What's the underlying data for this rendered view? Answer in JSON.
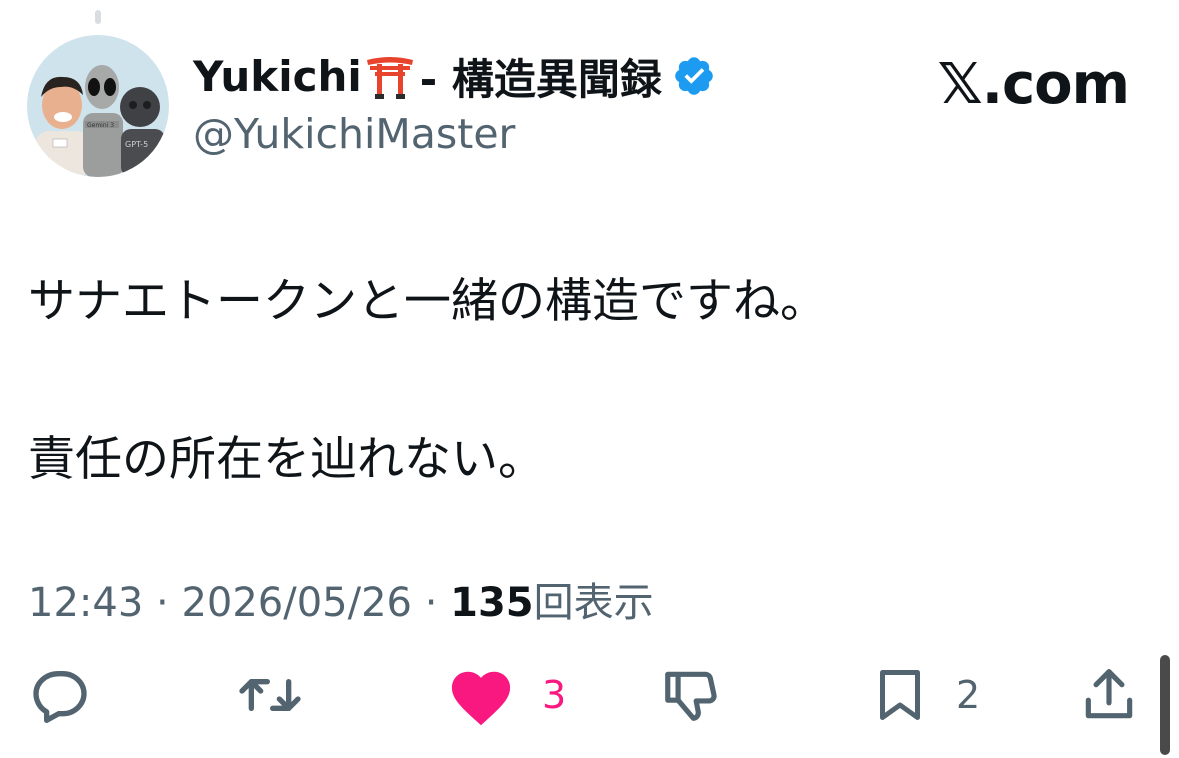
{
  "author": {
    "display_name": "Yukichi",
    "name_suffix": " - 構造異聞録",
    "handle": "@YukichiMaster",
    "verified": true,
    "name_emoji": "torii-gate-icon",
    "avatar_labels": [
      "Gemini 3",
      "GPT-5"
    ]
  },
  "site": {
    "label": "𝕏.com"
  },
  "tweet": {
    "text_line1": "サナエトークンと一緒の構造ですね。",
    "text_line2": "責任の所在を辿れない。"
  },
  "meta": {
    "time": "12:43",
    "separator": " · ",
    "date": "2026/05/26",
    "views_count": "135",
    "views_label": "回表示"
  },
  "actions": {
    "reply_icon": "reply-icon",
    "retweet_icon": "retweet-icon",
    "like_icon": "heart-icon",
    "like_count": "3",
    "dislike_icon": "dislike-icon",
    "bookmark_icon": "bookmark-icon",
    "bookmark_count": "2",
    "share_icon": "share-icon"
  },
  "colors": {
    "text": "#0f1419",
    "secondary": "#536471",
    "like_pink": "#f91880",
    "verified_blue": "#1d9bf0",
    "torii_red": "#e8432c"
  }
}
